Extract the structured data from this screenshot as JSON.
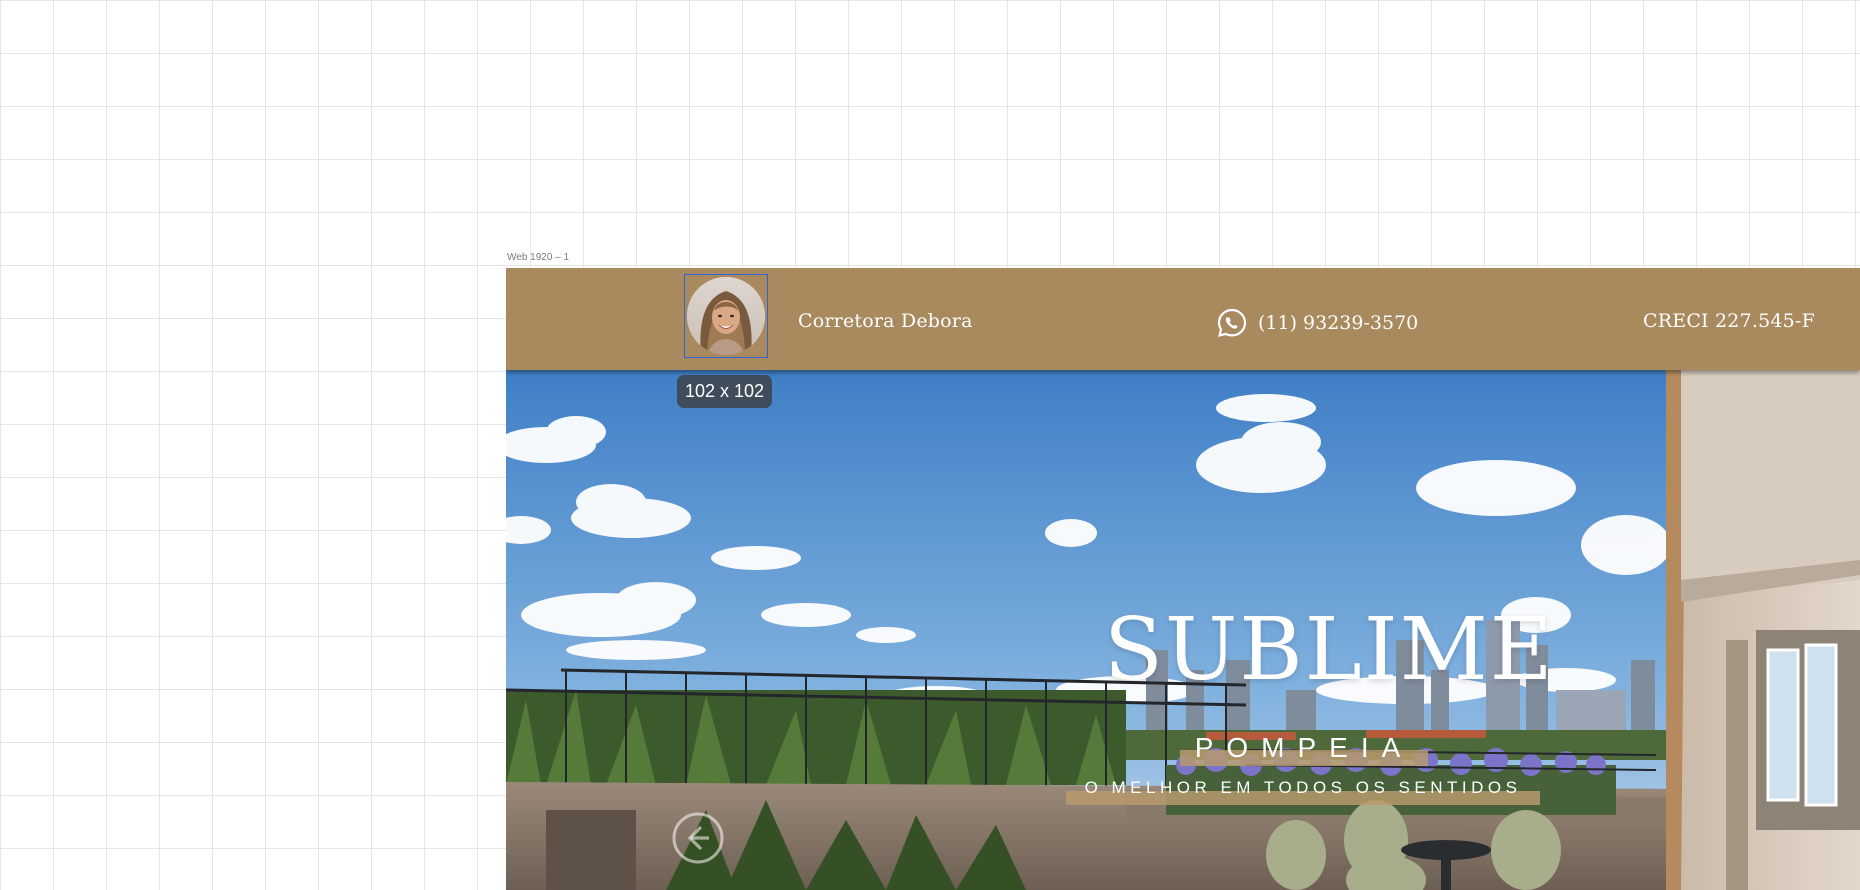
{
  "canvas": {
    "artboard_label": "Web 1920 – 1",
    "selection_size_tooltip": "102 x 102"
  },
  "header": {
    "broker_name": "Corretora Debora",
    "phone": "(11) 93239-3570",
    "creci": "CRECI 227.545-F",
    "icons": [
      "avatar-photo",
      "whatsapp-icon"
    ]
  },
  "hero": {
    "title": "SUBLIME",
    "subtitle": "POMPEIA",
    "tagline": "O MELHOR EM TODOS OS SENTIDOS",
    "nav_icon": "arrow-left-circle-icon"
  },
  "colors": {
    "header_bg": "#a88a5e",
    "band": "#b79a6c",
    "sky": "#4f86c4",
    "tooltip_bg": "#3e4c5c",
    "selection_border": "#2f63d6"
  }
}
